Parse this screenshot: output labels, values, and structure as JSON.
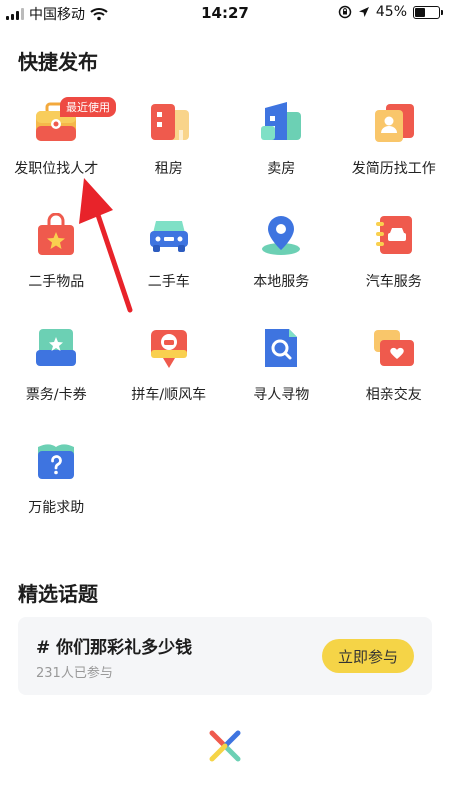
{
  "status_bar": {
    "carrier": "中国移动",
    "time": "14:27",
    "battery": "45%",
    "battery_level": 0.45,
    "icons": [
      "signal-icon",
      "wifi-icon",
      "rotation-lock-icon",
      "location-arrow-icon",
      "battery-icon"
    ]
  },
  "quick_post": {
    "title": "快捷发布",
    "badge": "最近使用",
    "items": [
      {
        "label": "发职位找人才",
        "icon": "briefcase-icon"
      },
      {
        "label": "租房",
        "icon": "rent-house-icon"
      },
      {
        "label": "卖房",
        "icon": "sell-house-icon"
      },
      {
        "label": "发简历找工作",
        "icon": "resume-icon"
      },
      {
        "label": "二手物品",
        "icon": "shopping-bag-icon"
      },
      {
        "label": "二手车",
        "icon": "car-icon"
      },
      {
        "label": "本地服务",
        "icon": "location-pin-icon"
      },
      {
        "label": "汽车服务",
        "icon": "car-service-book-icon"
      },
      {
        "label": "票务/卡券",
        "icon": "ticket-icon"
      },
      {
        "label": "拼车/顺风车",
        "icon": "carpool-pin-icon"
      },
      {
        "label": "寻人寻物",
        "icon": "search-document-icon"
      },
      {
        "label": "相亲交友",
        "icon": "heart-chat-icon"
      },
      {
        "label": "万能求助",
        "icon": "question-book-icon"
      }
    ]
  },
  "topics": {
    "title": "精选话题",
    "card": {
      "title": "# 你们那彩礼多少钱",
      "participants": "231人已参与",
      "button_label": "立即参与"
    }
  },
  "colors": {
    "accent_yellow": "#f5d447",
    "badge_red": "#ee4a43",
    "card_bg": "#f5f6f8",
    "arrow_red": "#e8232a"
  }
}
